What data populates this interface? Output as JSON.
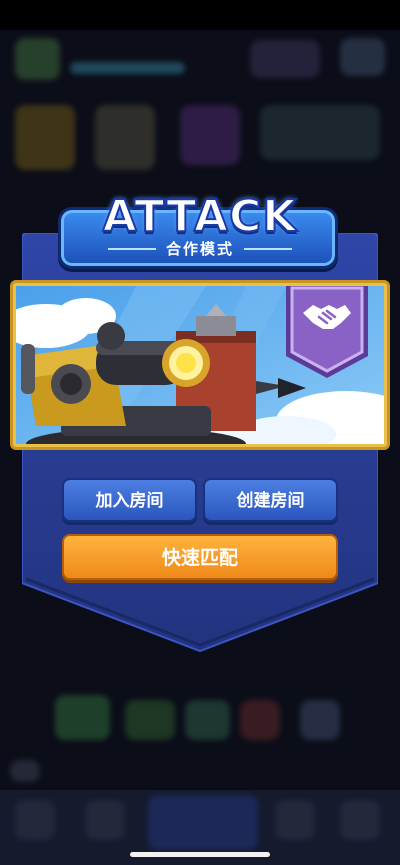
{
  "mode": {
    "title": "ATTACK",
    "subtitle": "合作模式",
    "badge_icon": "handshake-icon"
  },
  "buttons": {
    "join_room": "加入房间",
    "create_room": "创建房间",
    "quick_match": "快速匹配"
  },
  "colors": {
    "panel": "#283b9a",
    "accent_blue": "#3c8df0",
    "quick_match": "#f5a021",
    "frame_gold": "#e8c04a",
    "badge_purple": "#8a62c6"
  }
}
